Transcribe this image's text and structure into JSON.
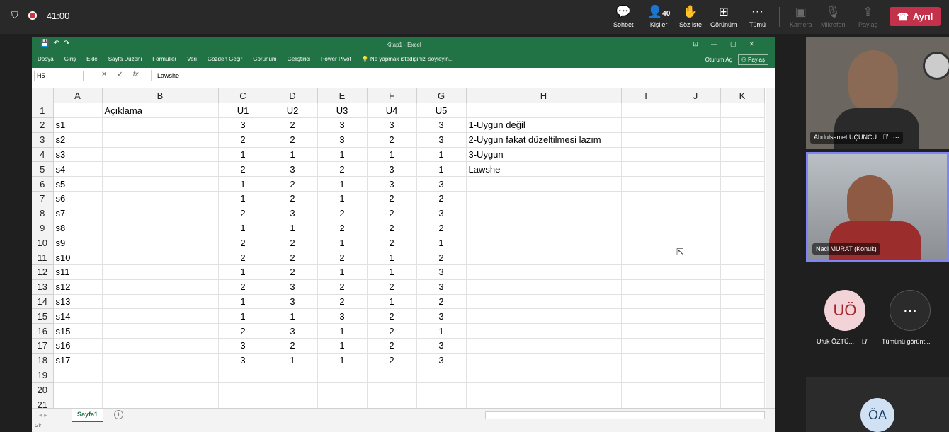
{
  "call": {
    "timer": "41:00",
    "buttons": [
      {
        "label": "Sohbet",
        "icon": "chat-icon"
      },
      {
        "label": "Kişiler",
        "count": "40",
        "icon": "people-icon"
      },
      {
        "label": "Söz iste",
        "icon": "raise-hand-icon"
      },
      {
        "label": "Görünüm",
        "icon": "grid-view-icon"
      },
      {
        "label": "Tümü",
        "icon": "more-icon"
      },
      {
        "label": "Kamera",
        "icon": "camera-off-icon"
      },
      {
        "label": "Mikrofon",
        "icon": "mic-off-icon"
      },
      {
        "label": "Paylaş",
        "icon": "share-icon"
      }
    ],
    "leave_label": "Ayrıl"
  },
  "excel": {
    "title": "Kitap1 - Excel",
    "tabs": [
      "Dosya",
      "Giriş",
      "Ekle",
      "Sayfa Düzeni",
      "Formüller",
      "Veri",
      "Gözden Geçir",
      "Görünüm",
      "Geliştirici",
      "Power Pivot"
    ],
    "tell_me": "Ne yapmak istediğinizi söyleyin...",
    "signin": "Oturum Aç",
    "share": "Paylaş",
    "name_box": "H5",
    "formula": "Lawshe",
    "columns": [
      "A",
      "B",
      "C",
      "D",
      "E",
      "F",
      "G",
      "H",
      "I",
      "J",
      "K"
    ],
    "rows": [
      [
        "",
        "Açıklama",
        "U1",
        "U2",
        "U3",
        "U4",
        "U5",
        "",
        "",
        "",
        ""
      ],
      [
        "s1",
        "",
        "3",
        "2",
        "3",
        "3",
        "3",
        "1-Uygun değil",
        "",
        "",
        ""
      ],
      [
        "s2",
        "",
        "2",
        "2",
        "3",
        "2",
        "3",
        "2-Uygun fakat düzeltilmesi lazım",
        "",
        "",
        ""
      ],
      [
        "s3",
        "",
        "1",
        "1",
        "1",
        "1",
        "1",
        "3-Uygun",
        "",
        "",
        ""
      ],
      [
        "s4",
        "",
        "2",
        "3",
        "2",
        "3",
        "1",
        "Lawshe",
        "",
        "",
        ""
      ],
      [
        "s5",
        "",
        "1",
        "2",
        "1",
        "3",
        "3",
        "",
        "",
        "",
        ""
      ],
      [
        "s6",
        "",
        "1",
        "2",
        "1",
        "2",
        "2",
        "",
        "",
        "",
        ""
      ],
      [
        "s7",
        "",
        "2",
        "3",
        "2",
        "2",
        "3",
        "",
        "",
        "",
        ""
      ],
      [
        "s8",
        "",
        "1",
        "1",
        "2",
        "2",
        "2",
        "",
        "",
        "",
        ""
      ],
      [
        "s9",
        "",
        "2",
        "2",
        "1",
        "2",
        "1",
        "",
        "",
        "",
        ""
      ],
      [
        "s10",
        "",
        "2",
        "2",
        "2",
        "1",
        "2",
        "",
        "",
        "",
        ""
      ],
      [
        "s11",
        "",
        "1",
        "2",
        "1",
        "1",
        "3",
        "",
        "",
        "",
        ""
      ],
      [
        "s12",
        "",
        "2",
        "3",
        "2",
        "2",
        "3",
        "",
        "",
        "",
        ""
      ],
      [
        "s13",
        "",
        "1",
        "3",
        "2",
        "1",
        "2",
        "",
        "",
        "",
        ""
      ],
      [
        "s14",
        "",
        "1",
        "1",
        "3",
        "2",
        "3",
        "",
        "",
        "",
        ""
      ],
      [
        "s15",
        "",
        "2",
        "3",
        "1",
        "2",
        "1",
        "",
        "",
        "",
        ""
      ],
      [
        "s16",
        "",
        "3",
        "2",
        "1",
        "2",
        "3",
        "",
        "",
        "",
        ""
      ],
      [
        "s17",
        "",
        "3",
        "1",
        "1",
        "2",
        "3",
        "",
        "",
        "",
        ""
      ],
      [
        "",
        "",
        "",
        "",
        "",
        "",
        "",
        "",
        "",
        "",
        ""
      ],
      [
        "",
        "",
        "",
        "",
        "",
        "",
        "",
        "",
        "",
        "",
        ""
      ],
      [
        "",
        "",
        "",
        "",
        "",
        "",
        "",
        "",
        "",
        "",
        ""
      ]
    ],
    "sheet_tab": "Sayfa1",
    "status_ready": "Gir"
  },
  "participants": {
    "p1_name": "Abdulsamet ÜÇÜNCÜ",
    "p2_name": "Naci MURAT (Konuk)",
    "p3_initials": "UÖ",
    "p3_name": "Ufuk ÖZTÜ...",
    "more_label": "Tümünü görünt...",
    "p4_initials": "ÖA"
  },
  "colors": {
    "excel_green": "#217346",
    "leave_red": "#c4314b",
    "selected_border": "#7f85f5"
  }
}
